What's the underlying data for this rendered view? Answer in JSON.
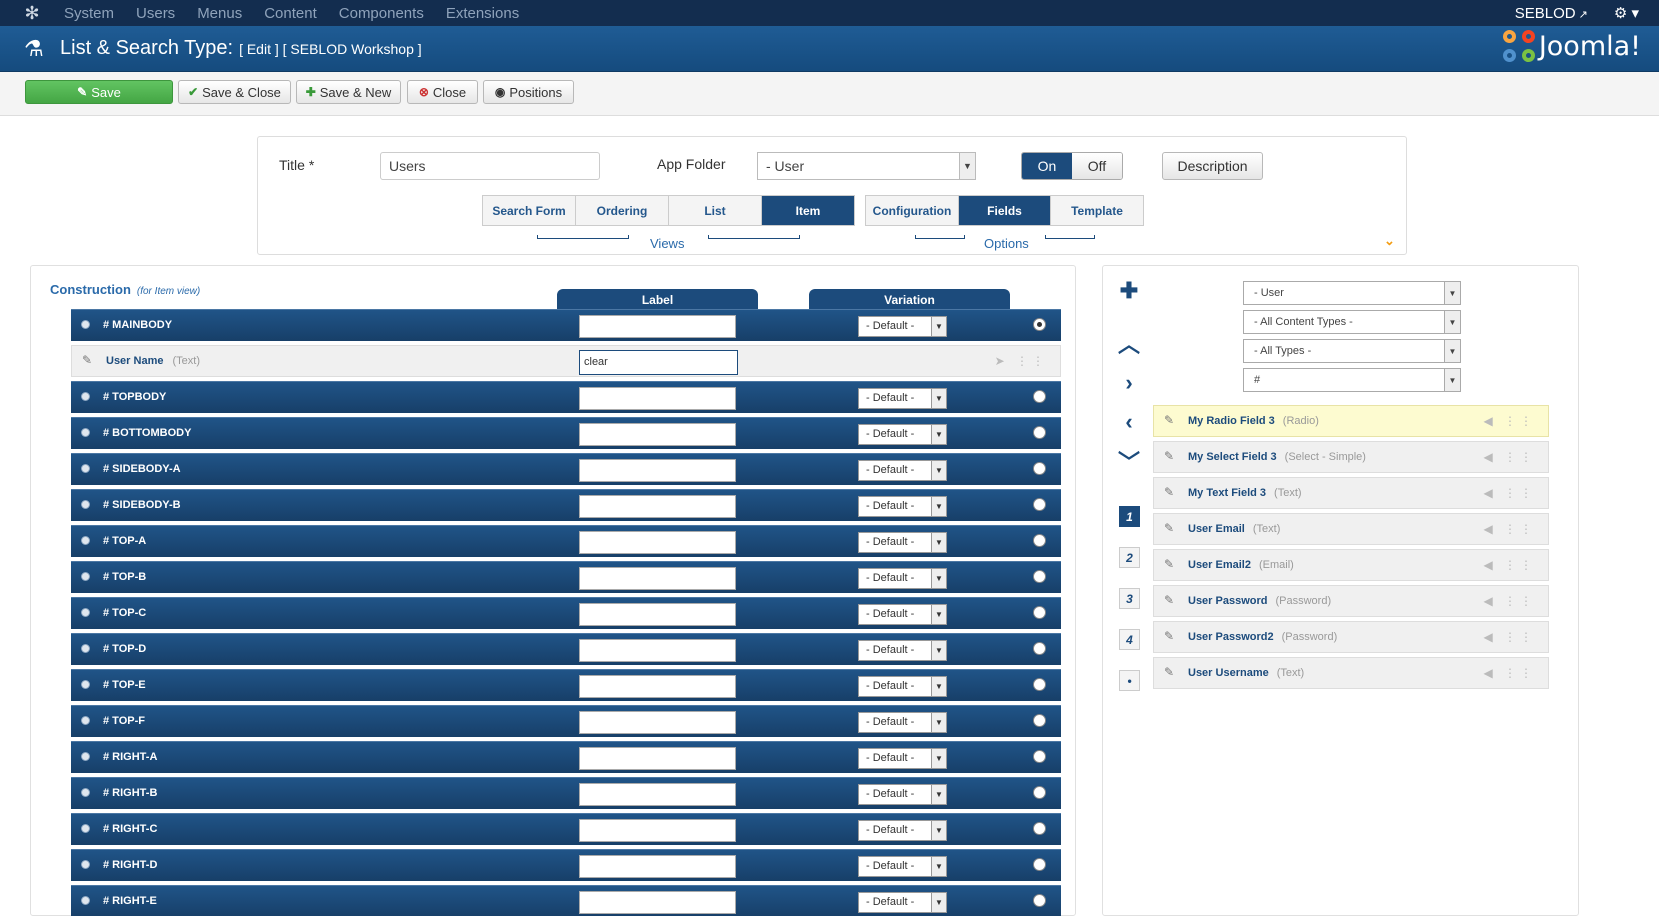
{
  "topnav": {
    "menu": [
      "System",
      "Users",
      "Menus",
      "Content",
      "Components",
      "Extensions"
    ],
    "user": "SEBLOD",
    "settings_icon": "gear-icon"
  },
  "header": {
    "title": "List & Search Type:",
    "subtitle": "[ Edit ] [ SEBLOD Workshop ]",
    "brand": "Joomla!"
  },
  "toolbar": {
    "save": "Save",
    "save_close": "Save & Close",
    "save_new": "Save & New",
    "close": "Close",
    "positions": "Positions"
  },
  "form": {
    "title_label": "Title",
    "required_mark": "*",
    "title_value": "Users",
    "app_folder_label": "App Folder",
    "app_folder_value": "- User",
    "on": "On",
    "off": "Off",
    "description": "Description",
    "views_tabs": [
      "Search Form",
      "Ordering",
      "List",
      "Item"
    ],
    "views_active": "Item",
    "views_label": "Views",
    "options_tabs": [
      "Configuration",
      "Fields",
      "Template"
    ],
    "options_active": "Fields",
    "options_label": "Options"
  },
  "construction": {
    "title": "Construction",
    "subtitle": "(for Item view)",
    "col_label": "Label",
    "col_variation": "Variation",
    "variation_default": "- Default -",
    "positions": [
      {
        "name": "# MAINBODY",
        "selected": true
      },
      {
        "name": "# TOPBODY",
        "selected": false
      },
      {
        "name": "# BOTTOMBODY",
        "selected": false
      },
      {
        "name": "# SIDEBODY-A",
        "selected": false
      },
      {
        "name": "# SIDEBODY-B",
        "selected": false
      },
      {
        "name": "# TOP-A",
        "selected": false
      },
      {
        "name": "# TOP-B",
        "selected": false
      },
      {
        "name": "# TOP-C",
        "selected": false
      },
      {
        "name": "# TOP-D",
        "selected": false
      },
      {
        "name": "# TOP-E",
        "selected": false
      },
      {
        "name": "# TOP-F",
        "selected": false
      },
      {
        "name": "# RIGHT-A",
        "selected": false
      },
      {
        "name": "# RIGHT-B",
        "selected": false
      },
      {
        "name": "# RIGHT-C",
        "selected": false
      },
      {
        "name": "# RIGHT-D",
        "selected": false
      },
      {
        "name": "# RIGHT-E",
        "selected": false
      }
    ],
    "assigned_field": {
      "name": "User Name",
      "type": "(Text)",
      "label_value": "clear",
      "after_position": 0
    }
  },
  "library": {
    "filters": [
      "- User",
      "- All Content Types -",
      "- All Types -",
      "#"
    ],
    "pages": [
      "1",
      "2",
      "3",
      "4",
      "•"
    ],
    "active_page": "1",
    "fields": [
      {
        "name": "My Radio Field 3",
        "type": "(Radio)",
        "highlight": true
      },
      {
        "name": "My Select Field 3",
        "type": "(Select - Simple)",
        "highlight": false
      },
      {
        "name": "My Text Field 3",
        "type": "(Text)",
        "highlight": false
      },
      {
        "name": "User Email",
        "type": "(Text)",
        "highlight": false
      },
      {
        "name": "User Email2",
        "type": "(Email)",
        "highlight": false
      },
      {
        "name": "User Password",
        "type": "(Password)",
        "highlight": false
      },
      {
        "name": "User Password2",
        "type": "(Password)",
        "highlight": false
      },
      {
        "name": "User Username",
        "type": "(Text)",
        "highlight": false
      }
    ]
  },
  "colors": {
    "navy": "#132d4f",
    "header_blue": "#1f5c95",
    "row_blue": "#1c4b7c",
    "save_green": "#51b551",
    "highlight_yellow": "#fdfbd0"
  }
}
